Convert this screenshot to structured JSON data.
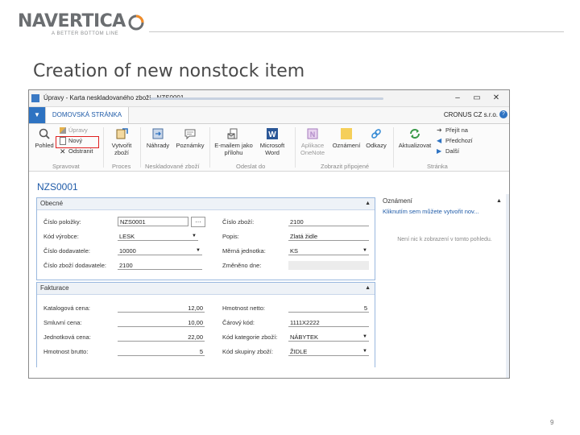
{
  "logo": {
    "word": "NAVERTICA",
    "tagline": "A BETTER BOTTOM LINE",
    "colors": {
      "word": "#6b6e71",
      "accent": "#f28c28"
    }
  },
  "slide": {
    "title": "Creation of new nonstock item",
    "page_number": "9"
  },
  "window": {
    "title": "Úpravy - Karta neskladovaného zboží - NZS0001",
    "buttons": {
      "minimize": "–",
      "restore": "▭",
      "close": "✕"
    }
  },
  "ribbon_tabs": {
    "file": "▼",
    "home": "DOMOVSKÁ STRÁNKA",
    "company": "CRONUS CZ s.r.o.",
    "help": "?"
  },
  "ribbon": {
    "groups": {
      "manage": {
        "label": "Spravovat",
        "view": "Pohled",
        "edit": "Úpravy",
        "new": "Nový",
        "delete": "Odstranit"
      },
      "process": {
        "label": "Proces",
        "create_item_1": "Vytvořit",
        "create_item_2": "zboží"
      },
      "nonstock_item": {
        "label": "Neskladované zboží",
        "substitutions": "Náhrady",
        "comments": "Poznámky"
      },
      "send_to": {
        "label": "Odeslat do",
        "email_1": "E-mailem jako",
        "email_2": "přílohu",
        "word_1": "Microsoft",
        "word_2": "Word"
      },
      "show_attached": {
        "label": "Zobrazit připojené",
        "onenote_1": "Aplikace",
        "onenote_2": "OneNote",
        "notes": "Oznámení",
        "links": "Odkazy"
      },
      "page": {
        "label": "Stránka",
        "refresh": "Aktualizovat",
        "goto": "Přejít na",
        "previous": "Předchozí",
        "next": "Další"
      }
    }
  },
  "record": {
    "id": "NZS0001",
    "general": {
      "header": "Obecné",
      "item_no_label": "Číslo položky:",
      "item_no": "NZS0001",
      "manufacturer_code_label": "Kód výrobce:",
      "manufacturer_code": "LESK",
      "vendor_no_label": "Číslo dodavatele:",
      "vendor_no": "10000",
      "vendor_item_no_label": "Číslo zboží dodavatele:",
      "vendor_item_no": "2100",
      "item_no_right_label": "Číslo zboží:",
      "item_no_right": "2100",
      "description_label": "Popis:",
      "description": "Zlatá židle",
      "unit_of_measure_label": "Měrná jednotka:",
      "unit_of_measure": "KS",
      "last_modified_label": "Změněno dne:",
      "last_modified": ""
    },
    "invoicing": {
      "header": "Fakturace",
      "published_cost_label": "Katalogová cena:",
      "published_cost": "12,00",
      "negotiated_cost_label": "Smluvní cena:",
      "negotiated_cost": "10,00",
      "unit_price_label": "Jednotková cena:",
      "unit_price": "22,00",
      "gross_weight_label": "Hmotnost brutto:",
      "gross_weight": "5",
      "net_weight_label": "Hmotnost netto:",
      "net_weight": "5",
      "bar_code_label": "Čárový kód:",
      "bar_code": "1111X2222",
      "item_category_label": "Kód kategorie zboží:",
      "item_category": "NÁBYTEK",
      "product_group_label": "Kód skupiny zboží:",
      "product_group": "ŽIDLE"
    }
  },
  "factbox": {
    "header": "Oznámení",
    "link": "Kliknutím sem můžete vytvořit nov...",
    "empty": "Není nic k zobrazení v tomto pohledu."
  },
  "icons": {
    "window": "app-window-icon",
    "view": "view-icon",
    "edit": "pencil-icon",
    "new": "new-document-icon",
    "delete": "delete-icon",
    "create_item": "create-item-icon",
    "substitutions": "substitutions-icon",
    "comments": "comments-icon",
    "email": "email-icon",
    "word": "word-icon",
    "onenote": "onenote-icon",
    "notes": "notes-icon",
    "links": "links-icon",
    "refresh": "refresh-icon",
    "goto": "arrow-right-icon",
    "previous": "arrow-left-icon",
    "next": "arrow-right-icon",
    "collapse": "chevron-up-icon",
    "dropdown": "chevron-down-icon",
    "assist": "ellipsis-icon",
    "help": "help-icon"
  }
}
